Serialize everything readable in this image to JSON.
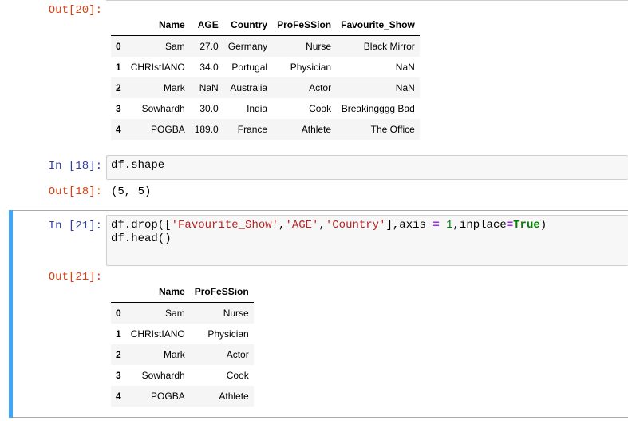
{
  "cells": {
    "out20": {
      "prompt": "Out[20]:",
      "columns": [
        "Name",
        "AGE",
        "Country",
        "ProFeSSion",
        "Favourite_Show"
      ],
      "index": [
        "0",
        "1",
        "2",
        "3",
        "4"
      ],
      "rows": [
        [
          "Sam",
          "27.0",
          "Germany",
          "Nurse",
          "Black Mirror"
        ],
        [
          "CHRIstIANO",
          "34.0",
          "Portugal",
          "Physician",
          "NaN"
        ],
        [
          "Mark",
          "NaN",
          "Australia",
          "Actor",
          "NaN"
        ],
        [
          "Sowhardh",
          "30.0",
          "India",
          "Cook",
          "Breakingggg Bad"
        ],
        [
          "POGBA",
          "189.0",
          "France",
          "Athlete",
          "The Office"
        ]
      ]
    },
    "in18": {
      "prompt": "In [18]:",
      "code": "df.shape"
    },
    "out18": {
      "prompt": "Out[18]:",
      "text": "(5, 5)"
    },
    "in21": {
      "prompt": "In [21]:",
      "code_tokens": {
        "t1": "df.drop([",
        "s1": "'Favourite_Show'",
        "c1": ",",
        "s2": "'AGE'",
        "c2": ",",
        "s3": "'Country'",
        "t2": "],axis ",
        "eq1": "=",
        "sp": " ",
        "n1": "1",
        "t3": ",inplace",
        "eq2": "=",
        "kw": "True",
        "t4": ")",
        "line2": "df.head()"
      }
    },
    "out21": {
      "prompt": "Out[21]:",
      "columns": [
        "Name",
        "ProFeSSion"
      ],
      "index": [
        "0",
        "1",
        "2",
        "3",
        "4"
      ],
      "rows": [
        [
          "Sam",
          "Nurse"
        ],
        [
          "CHRIstIANO",
          "Physician"
        ],
        [
          "Mark",
          "Actor"
        ],
        [
          "Sowhardh",
          "Cook"
        ],
        [
          "POGBA",
          "Athlete"
        ]
      ]
    }
  },
  "colors": {
    "selected_cell_bar": "#42a5f5",
    "out_prompt": "#d84315",
    "in_prompt": "#303f9f"
  }
}
